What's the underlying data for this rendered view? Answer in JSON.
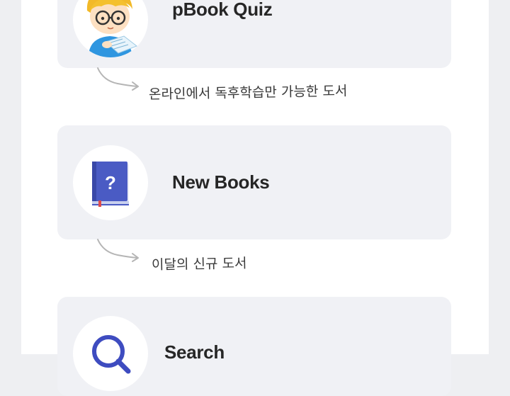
{
  "menu": {
    "items": [
      {
        "title": "pBook Quiz",
        "icon": "reading-child-icon",
        "caption": "온라인에서 독후학습만 가능한 도서"
      },
      {
        "title": "New Books",
        "icon": "question-book-icon",
        "caption": "이달의 신규 도서"
      },
      {
        "title": "Search",
        "icon": "search-icon",
        "caption": ""
      }
    ]
  },
  "colors": {
    "background": "#eeeff2",
    "panel": "#ffffff",
    "card": "#f0f1f5",
    "title_text": "#262626",
    "caption_text": "#3a3a3a",
    "book_blue": "#4a5bc4",
    "arrow_gray": "#b5b5b5"
  }
}
